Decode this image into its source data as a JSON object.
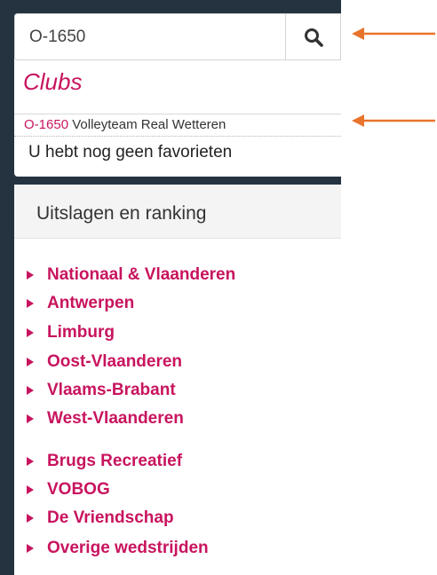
{
  "search": {
    "value": "O-1650"
  },
  "clubs": {
    "heading": "Clubs",
    "result": {
      "code": "O-1650",
      "name": "Volleyteam Real Wetteren"
    },
    "no_favorites": "U hebt nog geen favorieten"
  },
  "ranking": {
    "title": "Uitslagen en ranking",
    "links": [
      {
        "label": "Nationaal & Vlaanderen"
      },
      {
        "label": "Antwerpen"
      },
      {
        "label": "Limburg"
      },
      {
        "label": "Oost-Vlaanderen"
      },
      {
        "label": "Vlaams-Brabant"
      },
      {
        "label": "West-Vlaanderen"
      },
      {
        "label": "Brugs Recreatief"
      },
      {
        "label": "VOBOG"
      },
      {
        "label": "De Vriendschap"
      },
      {
        "label": "Overige wedstrijden"
      }
    ]
  },
  "colors": {
    "accent": "#c8145e",
    "frame": "#253341",
    "annotation_arrow": "#e8742c"
  },
  "icons": {
    "search": "search-icon",
    "caret": "caret-right-icon",
    "annotation": "arrow-left-icon"
  }
}
